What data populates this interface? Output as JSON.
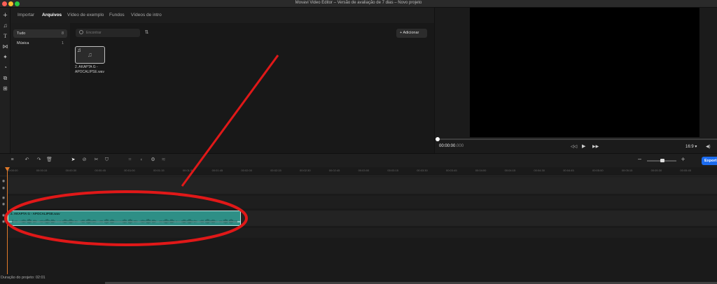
{
  "window": {
    "title": "Movavi Video Editor – Versão de avaliação de 7 dias – Novo projeto"
  },
  "tabs": [
    {
      "label": "Importar"
    },
    {
      "label": "Arquivos"
    },
    {
      "label": "Vídeo de exemplo"
    },
    {
      "label": "Fundos"
    },
    {
      "label": "Vídeos de intro"
    }
  ],
  "categories": [
    {
      "label": "Tudo",
      "count": "8"
    },
    {
      "label": "Música",
      "count": "1"
    }
  ],
  "search": {
    "placeholder": "Encontrar"
  },
  "add_button": {
    "label": "Adicionar",
    "icon": "plus-icon"
  },
  "media_item": {
    "caption_line1": "2. AKAPTA G -",
    "caption_line2": "APOCALIPSE.wav"
  },
  "preview": {
    "timecode": "00:00:00",
    "timecode_ms": ".000",
    "aspect": "16:9",
    "progress": 0
  },
  "export": {
    "label": "Export"
  },
  "ruler_ticks": [
    "00:00:00",
    "00:00:15",
    "00:00:30",
    "00:00:45",
    "00:01:00",
    "00:01:15",
    "00:01:30",
    "00:01:45",
    "00:02:00",
    "00:02:15",
    "00:02:30",
    "00:02:45",
    "00:03:00",
    "00:03:15",
    "00:03:30",
    "00:03:45",
    "00:04:00",
    "00:04:15",
    "00:04:30",
    "00:04:45",
    "00:05:00",
    "00:05:15",
    "00:05:30",
    "00:05:45"
  ],
  "clip": {
    "title": "2. AKAPTA G - APOCALIPSE.wav"
  },
  "footer": {
    "duration": "Duração do projeto: 02:01"
  },
  "colors": {
    "accent": "#1c6cf0",
    "clip": "#2e8f86",
    "playhead": "#e07a2a",
    "annotation": "#e01818"
  }
}
